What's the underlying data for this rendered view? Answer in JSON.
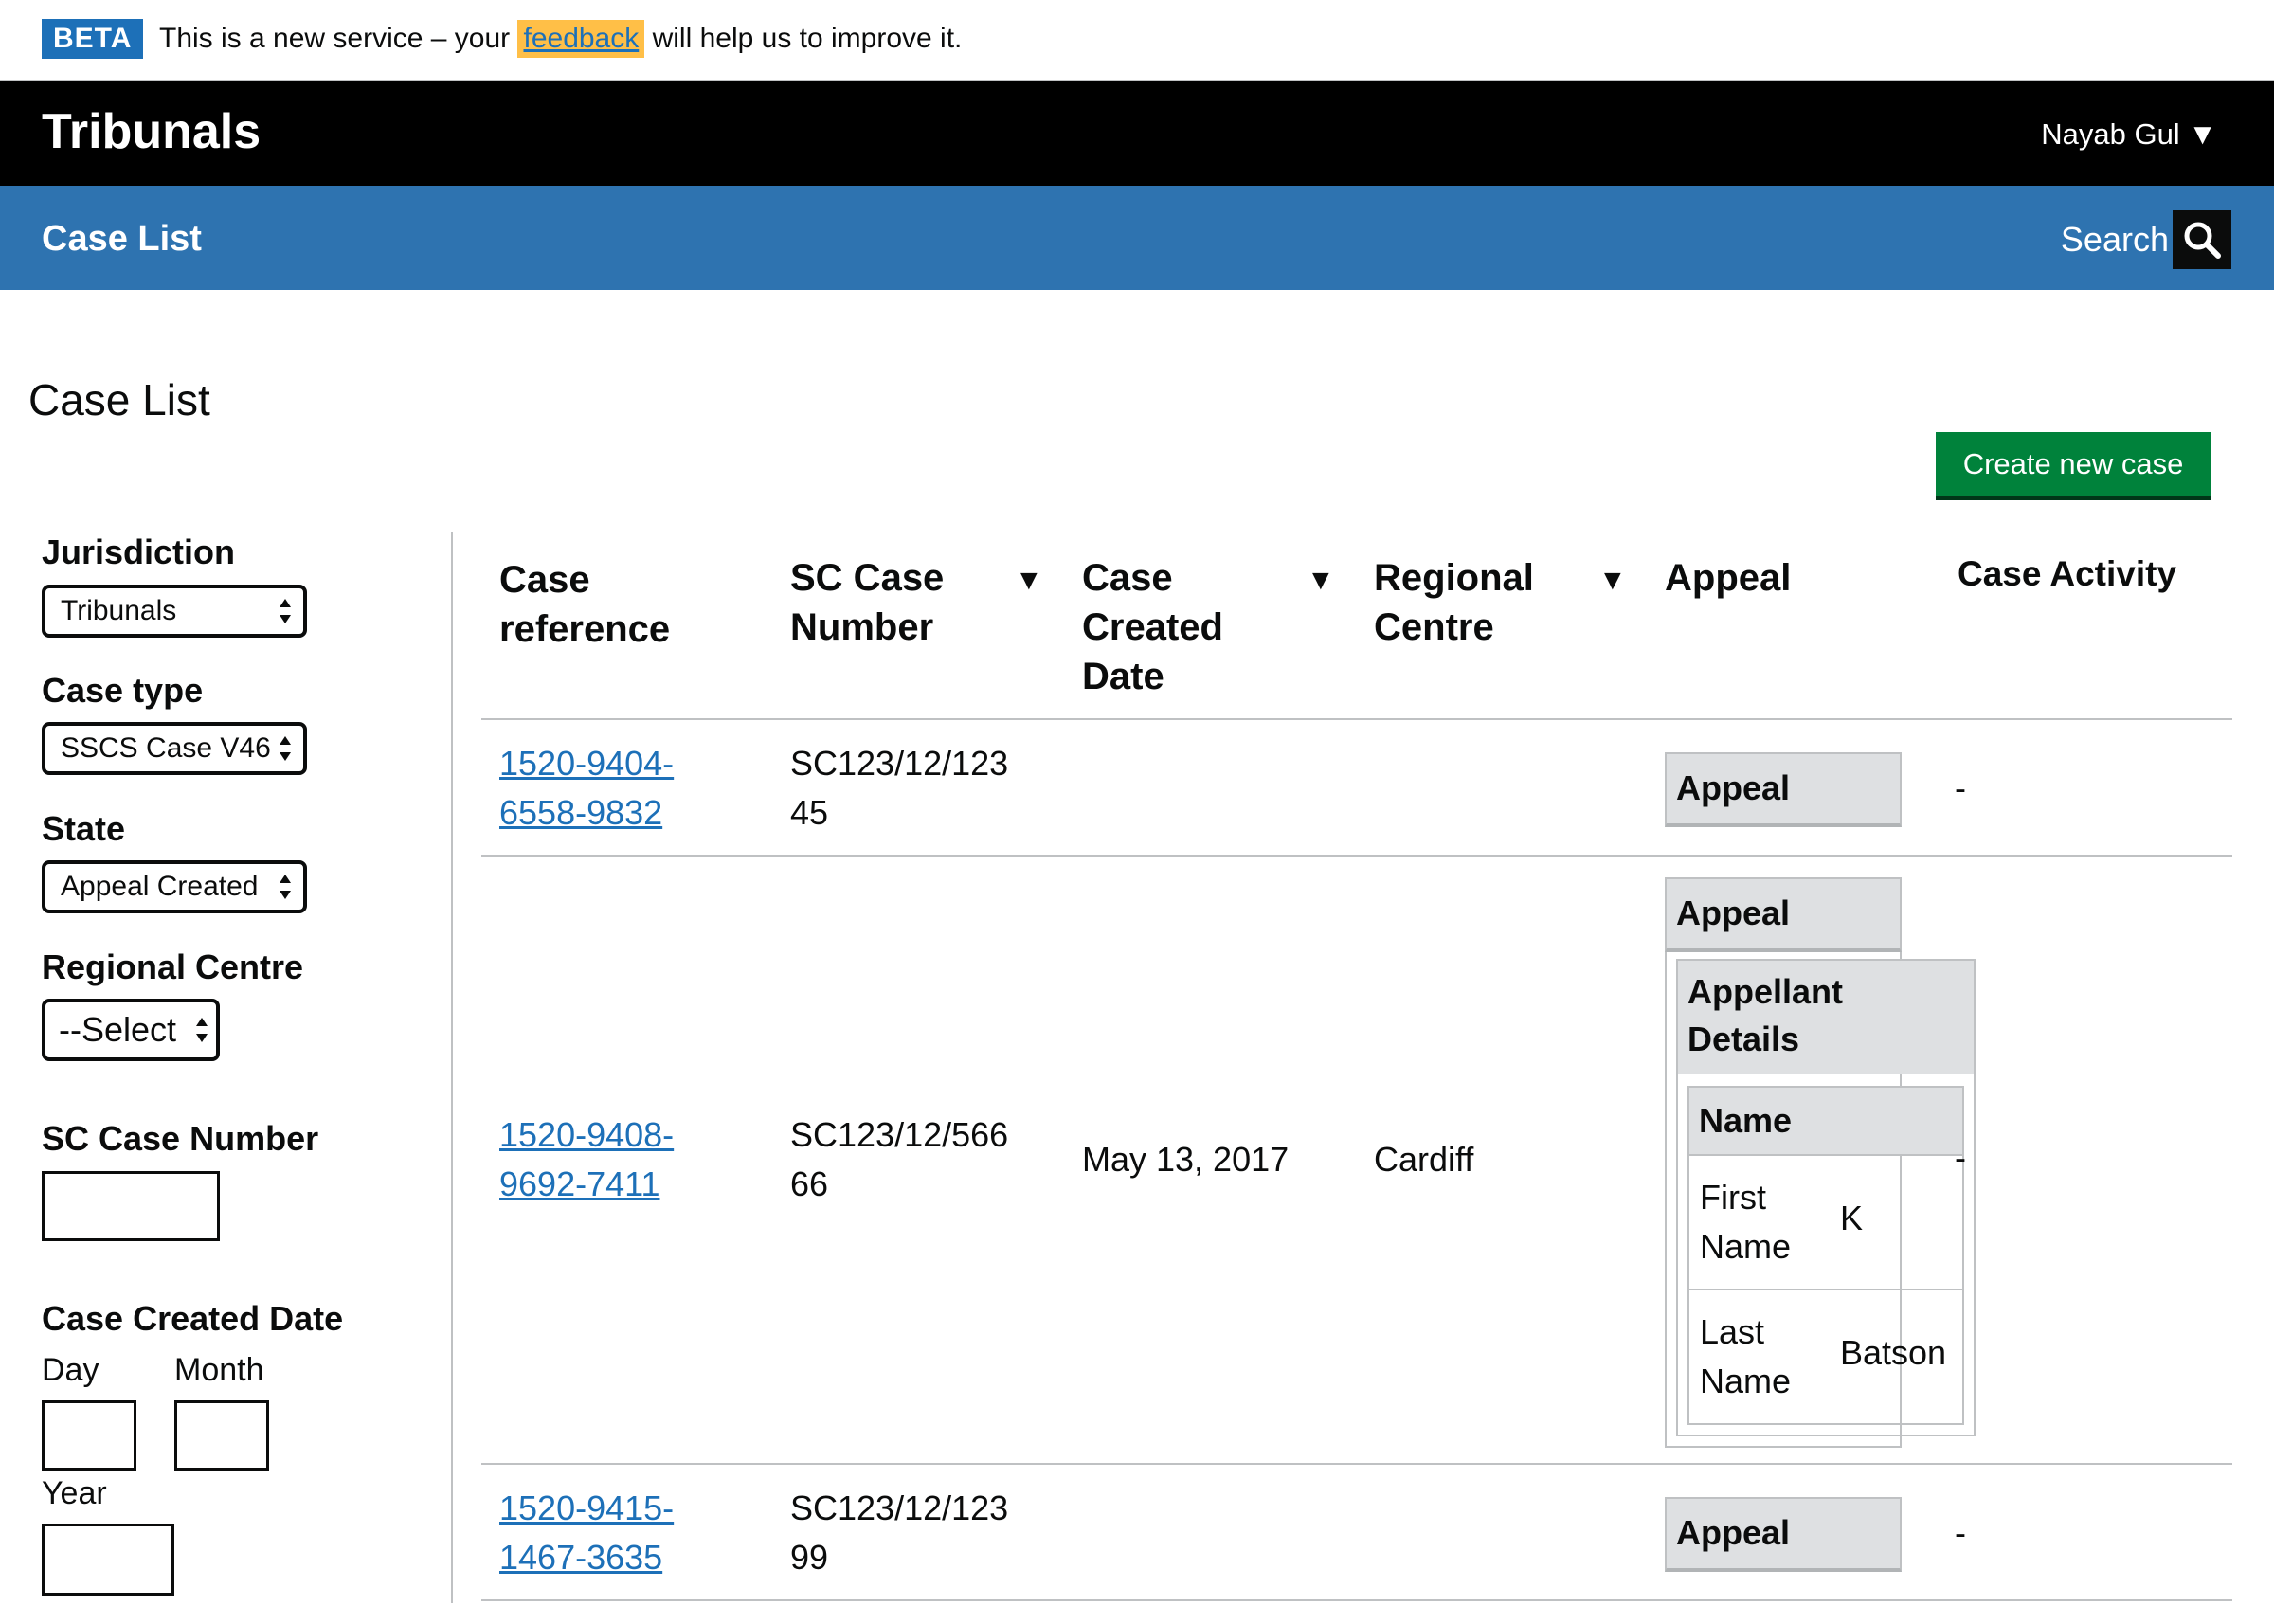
{
  "beta_banner": {
    "tag": "BETA",
    "text_before": "This is a new service – your",
    "link": "feedback",
    "text_after": "will help us to improve it."
  },
  "header": {
    "brand": "Tribunals",
    "user": "Nayab Gul ▼"
  },
  "nav": {
    "case_list": "Case List",
    "search": "Search"
  },
  "page": {
    "title": "Case List",
    "create_button": "Create new case"
  },
  "filters": {
    "jurisdiction_label": "Jurisdiction",
    "jurisdiction_value": "Tribunals",
    "case_type_label": "Case type",
    "case_type_value": "SSCS Case V46",
    "state_label": "State",
    "state_value": "Appeal Created",
    "regional_centre_label": "Regional Centre",
    "regional_centre_value": "--Select",
    "sc_case_number_label": "SC Case Number",
    "case_created_date_label": "Case Created Date",
    "day_label": "Day",
    "month_label": "Month",
    "year_label": "Year"
  },
  "table": {
    "headers": {
      "case_reference": "Case reference",
      "sc_case_number": "SC Case Number",
      "case_created_date": "Case Created Date",
      "regional_centre": "Regional Centre",
      "appeal": "Appeal",
      "case_activity": "Case Activity"
    },
    "sort_icon": "▼",
    "rows": [
      {
        "ref_line1": "1520-9404-",
        "ref_line2": "6558-9832",
        "sc_line1": "SC123/12/123",
        "sc_line2": "45",
        "created": "",
        "centre": "",
        "appeal": "Appeal",
        "activity": "-"
      },
      {
        "ref_line1": "1520-9408-",
        "ref_line2": "9692-7411",
        "sc_line1": "SC123/12/566",
        "sc_line2": "66",
        "created": "May 13, 2017",
        "centre": "Cardiff",
        "appeal": "Appeal",
        "appellant_details_line1": "Appellant",
        "appellant_details_line2": "Details",
        "name_label": "Name",
        "first_name_line1": "First",
        "first_name_line2": "Name",
        "first_name_value": "K",
        "last_name_line1": "Last",
        "last_name_line2": "Name",
        "last_name_value": "Batson",
        "activity": "-"
      },
      {
        "ref_line1": "1520-9415-",
        "ref_line2": "1467-3635",
        "sc_line1": "SC123/12/123",
        "sc_line2": "99",
        "created": "",
        "centre": "",
        "appeal": "Appeal",
        "activity": "-"
      }
    ]
  }
}
